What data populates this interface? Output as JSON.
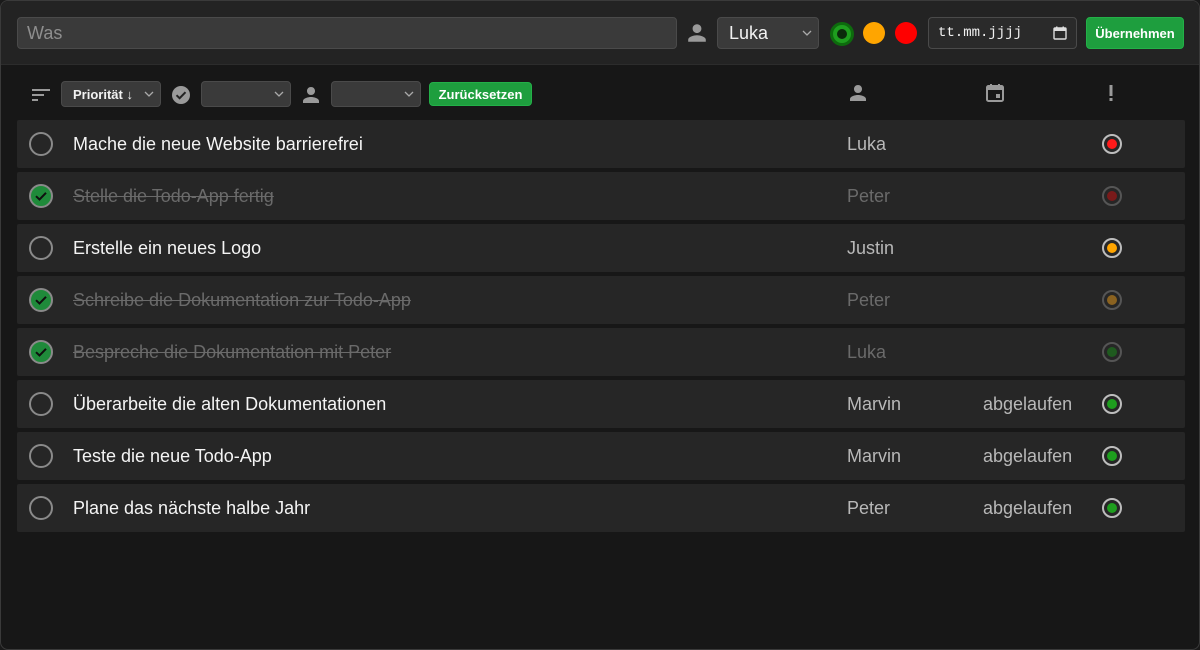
{
  "toolbar": {
    "search_placeholder": "Was",
    "user_select_value": "Luka",
    "date_placeholder": "tt.mm.jjjj",
    "apply_label": "Übernehmen",
    "priority_colors": {
      "low": "#1e9e1e",
      "medium": "#ffa500",
      "high": "#ff0000"
    }
  },
  "filters": {
    "sort_select_value": "Priorität ↓",
    "status_select_value": "",
    "user_select_value": "",
    "reset_label": "Zurücksetzen",
    "col_assignee_icon": "person-icon",
    "col_date_icon": "calendar-icon",
    "col_priority_icon": "exclamation-icon"
  },
  "tasks": [
    {
      "title": "Mache die neue Website barrierefrei",
      "assignee": "Luka",
      "due": "",
      "done": false,
      "priority_color": "#ff1a1a"
    },
    {
      "title": "Stelle die Todo-App fertig",
      "assignee": "Peter",
      "due": "",
      "done": true,
      "priority_color": "#7a1a1a"
    },
    {
      "title": "Erstelle ein neues Logo",
      "assignee": "Justin",
      "due": "",
      "done": false,
      "priority_color": "#ffa500"
    },
    {
      "title": "Schreibe die Dokumentation zur Todo-App",
      "assignee": "Peter",
      "due": "",
      "done": true,
      "priority_color": "#8a6220"
    },
    {
      "title": "Bespreche die Dokumentation mit Peter",
      "assignee": "Luka",
      "due": "",
      "done": true,
      "priority_color": "#1f5a1f"
    },
    {
      "title": "Überarbeite die alten Dokumentationen",
      "assignee": "Marvin",
      "due": "abgelaufen",
      "done": false,
      "priority_color": "#1e9e1e"
    },
    {
      "title": "Teste die neue Todo-App",
      "assignee": "Marvin",
      "due": "abgelaufen",
      "done": false,
      "priority_color": "#1e9e1e"
    },
    {
      "title": "Plane das nächste halbe Jahr",
      "assignee": "Peter",
      "due": "abgelaufen",
      "done": false,
      "priority_color": "#1e9e1e"
    }
  ]
}
